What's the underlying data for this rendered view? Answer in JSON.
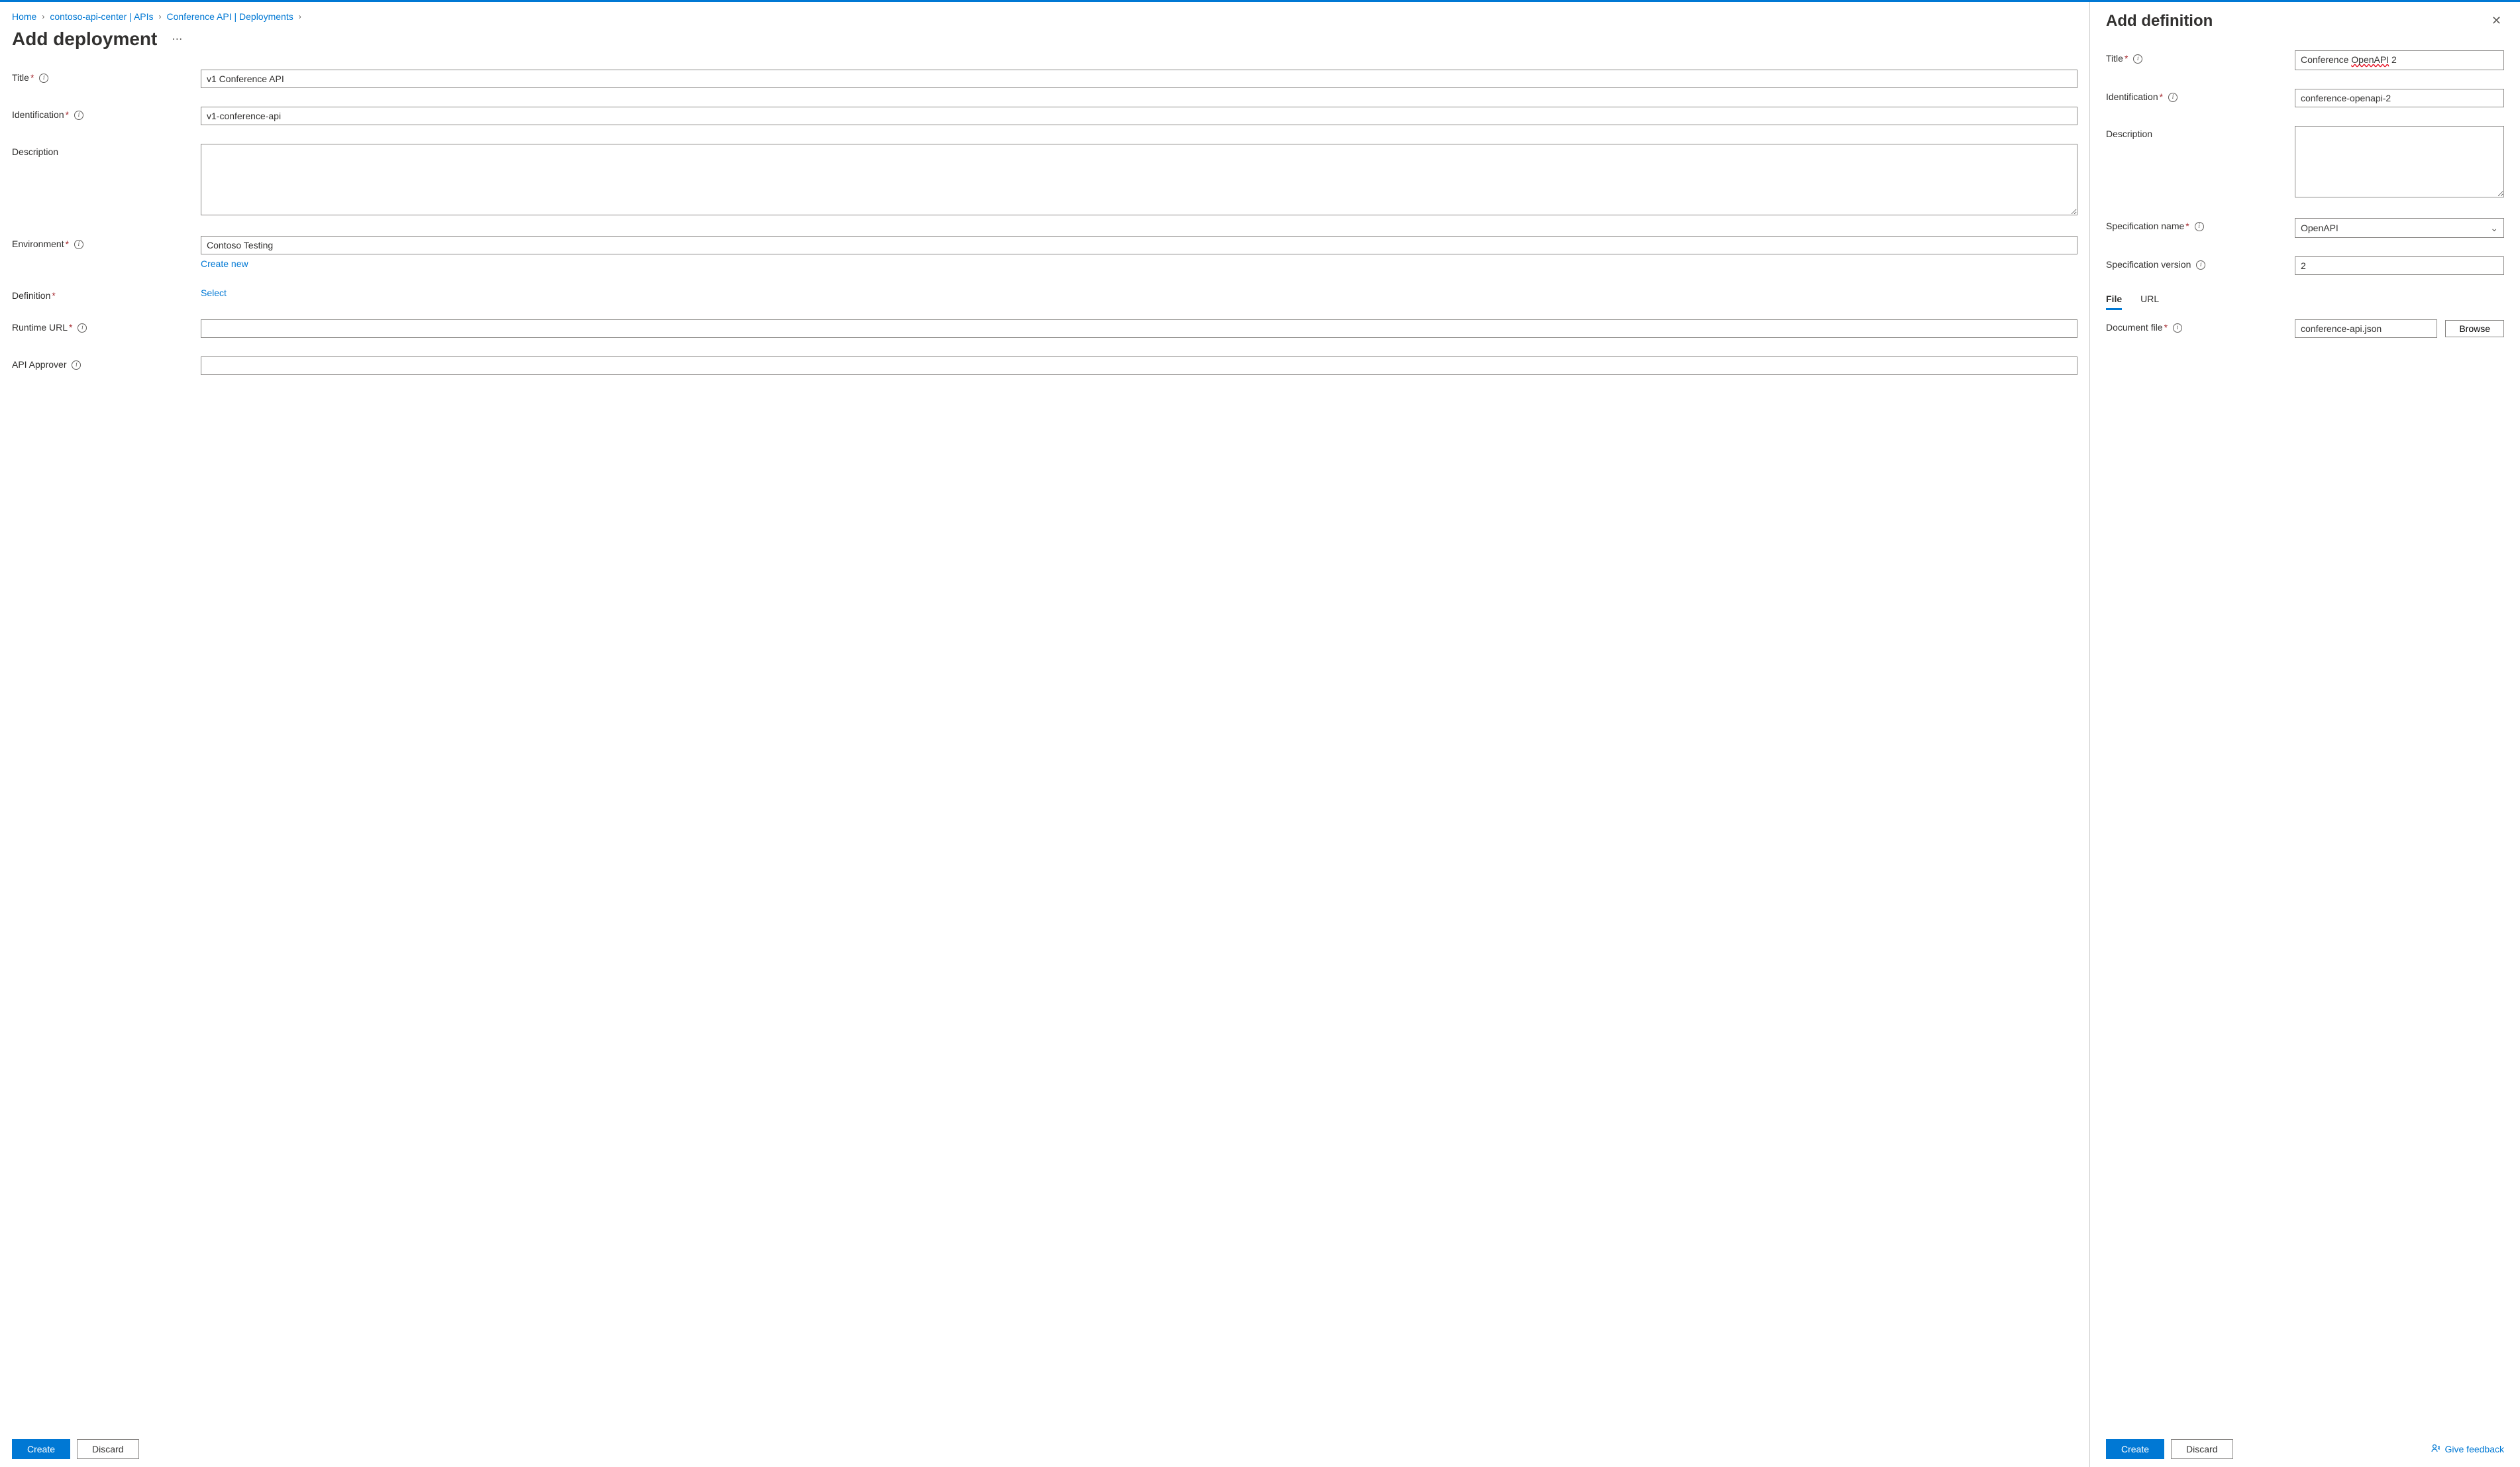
{
  "breadcrumb": {
    "items": [
      "Home",
      "contoso-api-center | APIs",
      "Conference API | Deployments"
    ]
  },
  "main": {
    "title": "Add deployment",
    "fields": {
      "title": {
        "label": "Title",
        "value": "v1 Conference API"
      },
      "identification": {
        "label": "Identification",
        "value": "v1-conference-api"
      },
      "description": {
        "label": "Description",
        "value": ""
      },
      "environment": {
        "label": "Environment",
        "value": "Contoso Testing",
        "create_new": "Create new"
      },
      "definition": {
        "label": "Definition",
        "select": "Select"
      },
      "runtime_url": {
        "label": "Runtime URL",
        "value": ""
      },
      "api_approver": {
        "label": "API Approver",
        "value": ""
      }
    },
    "buttons": {
      "create": "Create",
      "discard": "Discard"
    }
  },
  "panel": {
    "title": "Add definition",
    "fields": {
      "title": {
        "label": "Title",
        "value_prefix": "Conference ",
        "value_spell": "OpenAPI",
        "value_suffix": " 2"
      },
      "identification": {
        "label": "Identification",
        "value": "conference-openapi-2"
      },
      "description": {
        "label": "Description",
        "value": ""
      },
      "spec_name": {
        "label": "Specification name",
        "value": "OpenAPI"
      },
      "spec_version": {
        "label": "Specification version",
        "value": "2"
      },
      "doc_file": {
        "label": "Document file",
        "value": "conference-api.json",
        "browse": "Browse"
      }
    },
    "tabs": {
      "file": "File",
      "url": "URL"
    },
    "buttons": {
      "create": "Create",
      "discard": "Discard"
    },
    "feedback": "Give feedback"
  }
}
